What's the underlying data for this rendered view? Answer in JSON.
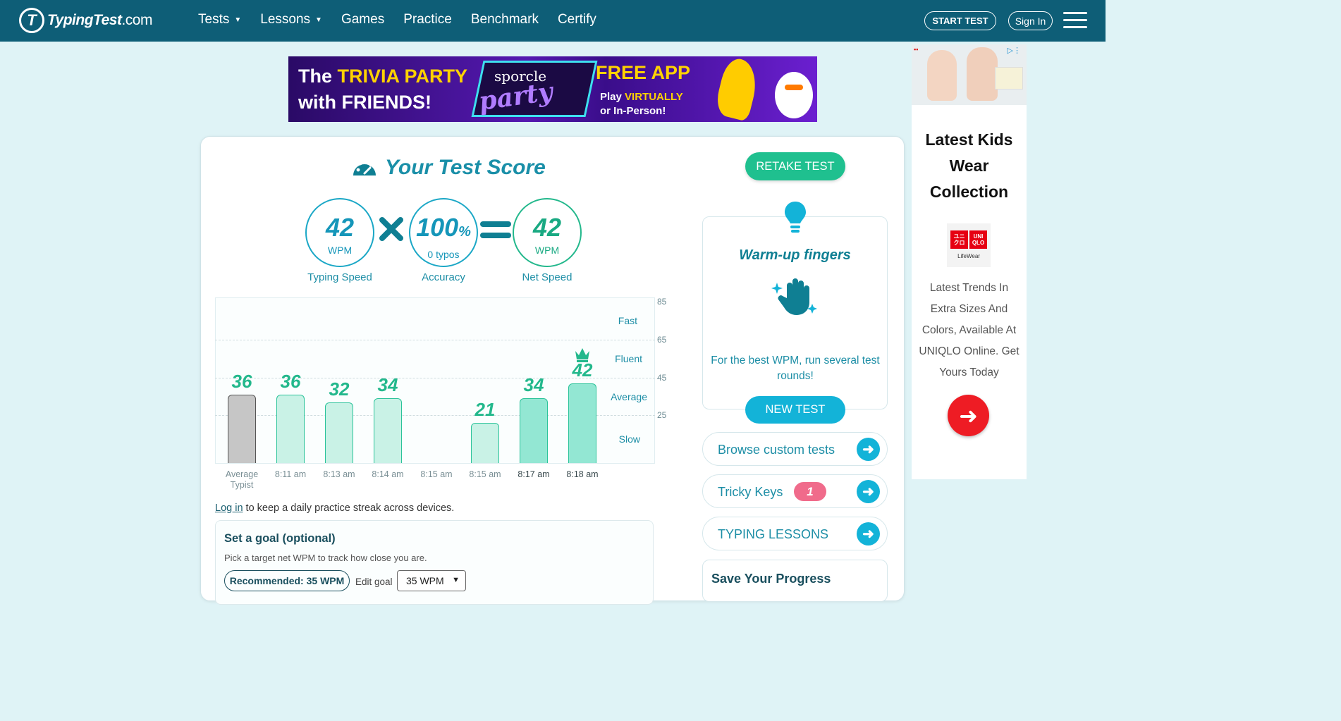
{
  "nav": {
    "logo_main": "TypingTest",
    "logo_domain": ".com",
    "links": [
      {
        "label": "Tests",
        "has_caret": true
      },
      {
        "label": "Lessons",
        "has_caret": true
      },
      {
        "label": "Games"
      },
      {
        "label": "Practice"
      },
      {
        "label": "Benchmark"
      },
      {
        "label": "Certify"
      }
    ],
    "start_test": "START TEST",
    "sign_in": "Sign In"
  },
  "banner_ad": {
    "line1_a": "The ",
    "line1_b": "TRIVIA PARTY",
    "line2": "with FRIENDS!",
    "brand_top": "sporcle",
    "brand_bottom": "party",
    "free_app": "FREE APP",
    "play_a": "Play ",
    "play_b": "VIRTUALLY",
    "play_c": "or In-Person!"
  },
  "score": {
    "title": "Your Test Score",
    "typing_speed": {
      "value": "42",
      "unit": "WPM",
      "label": "Typing Speed"
    },
    "accuracy": {
      "value": "100",
      "unit": "%",
      "sub": "0 typos",
      "label": "Accuracy"
    },
    "net_speed": {
      "value": "42",
      "unit": "WPM",
      "label": "Net Speed"
    }
  },
  "chart_data": {
    "type": "bar",
    "categories": [
      "Average Typist",
      "8:11 am",
      "8:13 am",
      "8:14 am",
      "8:15 am",
      "8:15 am",
      "8:17 am",
      "8:18 am"
    ],
    "values": [
      36,
      36,
      32,
      34,
      null,
      21,
      34,
      42
    ],
    "value_labels": [
      "36",
      "36",
      "32",
      "34",
      "",
      "21",
      "34",
      "42"
    ],
    "y_ticks": [
      "85",
      "65",
      "45",
      "25"
    ],
    "bands": [
      "Fast",
      "Fluent",
      "Average",
      "Slow"
    ],
    "ylim": [
      0,
      85
    ],
    "grid": "dashed horizontal",
    "best_marker": "crown"
  },
  "login_prompt": {
    "link": "Log in",
    "text": " to keep a daily practice streak across devices."
  },
  "goal": {
    "title": "Set a goal (optional)",
    "subtitle": "Pick a target net WPM to track how close you are.",
    "recommended": "Recommended: 35 WPM",
    "edit_label": "Edit goal",
    "selected": "35 WPM"
  },
  "sidebar": {
    "retake": "RETAKE TEST",
    "warmup_title": "Warm-up fingers",
    "warmup_text": "For the best WPM, run several test rounds!",
    "new_test": "NEW TEST",
    "links": [
      {
        "label": "Browse custom tests"
      },
      {
        "label": "Tricky Keys",
        "badge": "1"
      },
      {
        "label": "TYPING LESSONS"
      }
    ],
    "save_title": "Save Your Progress"
  },
  "side_ad": {
    "headline": "Latest Kids Wear Collection",
    "brand_box_1": "ユニ クロ",
    "brand_box_2": "UNI QLO",
    "brand_line": "LifeWear",
    "body": "Latest Trends In Extra Sizes And Colors, Available At UNIQLO Online. Get Yours Today"
  },
  "colors": {
    "nav_bg": "#0e5e77",
    "page_bg": "#dff3f6",
    "teal_text": "#1d8ea6",
    "green": "#23b88c",
    "blue_button": "#13b3d8",
    "retake_button": "#1fc08f",
    "badge_pink": "#f06b8b",
    "ad_red": "#ee1c24"
  }
}
